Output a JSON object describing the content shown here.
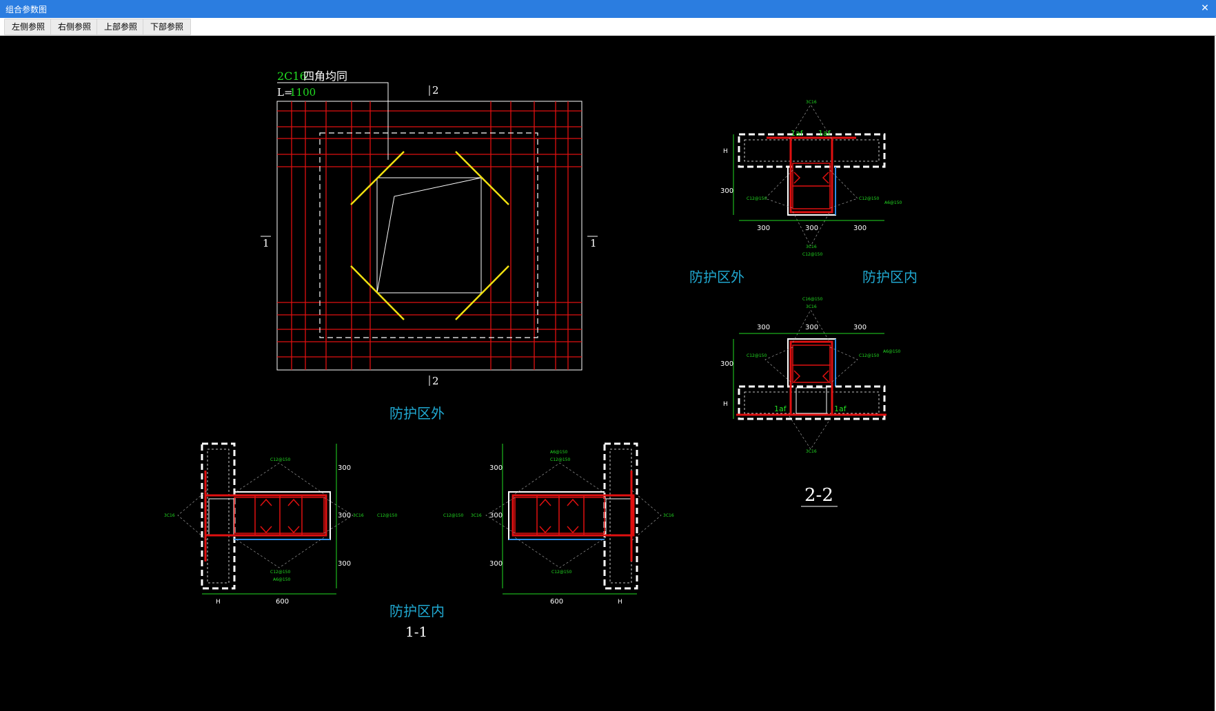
{
  "window": {
    "title": "组合参数图",
    "close_glyph": "✕"
  },
  "toolbar": {
    "buttons": [
      {
        "label": "左侧参照"
      },
      {
        "label": "右侧参照"
      },
      {
        "label": "上部参照"
      },
      {
        "label": "下部参照"
      }
    ]
  },
  "plan": {
    "rebar_label_green": "2C16",
    "rebar_label_white": "四角均同",
    "length_prefix": "L=",
    "length_value": "1100",
    "section_mark_top": "2",
    "section_mark_bottom": "2",
    "section_mark_left": "1",
    "section_mark_right": "1",
    "zone_caption": "防护区外"
  },
  "section_1_1": {
    "zone_caption": "防护区内",
    "title": "1-1",
    "left_detail": {
      "dims": [
        "300",
        "300",
        "300"
      ],
      "bottom_dims": [
        "H",
        "600"
      ],
      "labels": [
        "C12@150",
        "3C16",
        "C12@150",
        "A6@150",
        "3C16",
        "C12@150"
      ]
    },
    "right_detail": {
      "dims": [
        "300",
        "300",
        "300"
      ],
      "bottom_dims": [
        "600",
        "H"
      ],
      "labels": [
        "A6@150",
        "C12@150",
        "C12@150",
        "3C16",
        "C12@150",
        "3C16"
      ]
    }
  },
  "section_2_2": {
    "zone_outer": "防护区外",
    "zone_inner": "防护区内",
    "title": "2-2",
    "top_detail": {
      "dims": [
        "300",
        "300",
        "300"
      ],
      "side_dims": [
        "H",
        "300"
      ],
      "laf": [
        "1af",
        "1af"
      ],
      "labels": [
        "3C16",
        "C12@150",
        "C12@150",
        "A6@150",
        "3C16",
        "C12@150"
      ]
    },
    "bottom_detail": {
      "dims": [
        "300",
        "300",
        "300"
      ],
      "side_dims": [
        "300",
        "H"
      ],
      "laf": [
        "1af",
        "1af"
      ],
      "labels": [
        "C16@150",
        "3C16",
        "C12@150",
        "C12@150",
        "A6@150",
        "3C16"
      ]
    }
  },
  "colors": {
    "titlebar": "#2b7de0",
    "rebar": "#e01010",
    "yellow": "#f0e010",
    "green": "#22dd22",
    "cyan": "#20a8d0",
    "white": "#ffffff",
    "blue": "#2e8ee8"
  }
}
